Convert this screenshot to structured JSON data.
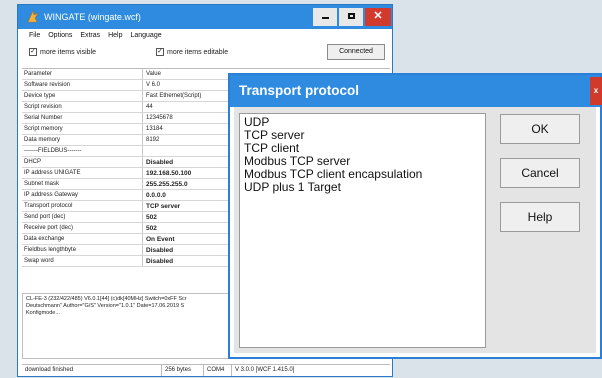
{
  "main_window": {
    "title": "WINGATE (wingate.wcf)",
    "menu": [
      "File",
      "Options",
      "Extras",
      "Help",
      "Language"
    ],
    "checkbox_more_visible": "more items visible",
    "checkbox_more_editable": "more items editable",
    "connected_button": "Connected",
    "grid_header": {
      "key": "Parameter",
      "value": "Value"
    },
    "rows": [
      {
        "key": "Software revision",
        "value": "V 6.0",
        "bold": false
      },
      {
        "key": "Device type",
        "value": "Fast Ethernet(Script)",
        "bold": false
      },
      {
        "key": "Script revision",
        "value": "44",
        "bold": false
      },
      {
        "key": "Serial Number",
        "value": "12345678",
        "bold": false
      },
      {
        "key": "Script memory",
        "value": "13184",
        "bold": false
      },
      {
        "key": "Data memory",
        "value": "8192",
        "bold": false
      },
      {
        "key": "-------FIELDBUS-------",
        "value": "",
        "bold": false
      },
      {
        "key": "DHCP",
        "value": "Disabled",
        "bold": true
      },
      {
        "key": "IP address UNIGATE",
        "value": "192.168.50.100",
        "bold": true
      },
      {
        "key": "Subnet mask",
        "value": "255.255.255.0",
        "bold": true
      },
      {
        "key": "IP address Gateway",
        "value": "0.0.0.0",
        "bold": true
      },
      {
        "key": "Transport protocol",
        "value": "TCP server",
        "bold": true
      },
      {
        "key": "Send port (dec)",
        "value": "502",
        "bold": true
      },
      {
        "key": "Receive port (dec)",
        "value": "502",
        "bold": true
      },
      {
        "key": "Data exchange",
        "value": "On Event",
        "bold": true
      },
      {
        "key": "Fieldbus lengthbyte",
        "value": "Disabled",
        "bold": true
      },
      {
        "key": "Swap word",
        "value": "Disabled",
        "bold": true
      }
    ],
    "info_lines": [
      "CL-FE-3 (232/422/485) V6.0.1[44] (c)dk[40MHz] Switch=0xFF Scr",
      "Deutschmann\" Author=\"G/S\" Version=\"1.0.1\" Date=17.06.2019 S",
      "Konfigmode..."
    ],
    "status": {
      "message": "download finished",
      "bytes": "256 bytes",
      "port": "COM4",
      "version": "V 3.0.0 [WCF 1.415.0]"
    }
  },
  "dialog": {
    "title": "Transport protocol",
    "close_glyph": "x",
    "options": [
      "UDP",
      "TCP server",
      "TCP client",
      "Modbus TCP server",
      "Modbus TCP client encapsulation",
      "UDP plus 1 Target"
    ],
    "ok_label": "OK",
    "cancel_label": "Cancel",
    "help_label": "Help"
  },
  "colors": {
    "titlebar": "#2e8be0",
    "close_button": "#cf3a2b",
    "dialog_background": "#e4e4e4",
    "desktop": "#dbe3ea"
  },
  "icons": [
    "app-icon",
    "minimize-icon",
    "maximize-icon",
    "close-icon",
    "checkbox-checked-icon"
  ]
}
